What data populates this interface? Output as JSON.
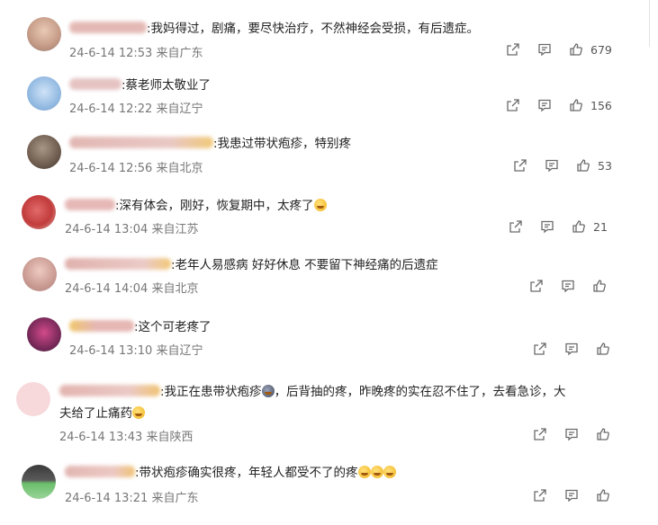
{
  "comments": [
    {
      "text": ":我妈得过，剧痛，要尽快治疗，不然神经会受损，有后遗症。",
      "date": "24-6-14 12:53",
      "location": "来自广东",
      "likes": "679"
    },
    {
      "text": ":蔡老师太敬业了",
      "date": "24-6-14 12:22",
      "location": "来自辽宁",
      "likes": "156"
    },
    {
      "text": ":我患过带状疱疹，特别疼",
      "date": "24-6-14 12:56",
      "location": "来自北京",
      "likes": "53"
    },
    {
      "text": ":深有体会，刚好，恢复期中，太疼了",
      "date": "24-6-14 13:04",
      "location": "来自江苏",
      "likes": "21"
    },
    {
      "text": ":老年人易感病 好好休息 不要留下神经痛的后遗症",
      "date": "24-6-14 14:04",
      "location": "来自北京",
      "likes": ""
    },
    {
      "text": ":这个可老疼了",
      "date": "24-6-14 13:10",
      "location": "来自辽宁",
      "likes": ""
    },
    {
      "text": ":我正在患带状疱疹",
      "text2": "，后背抽的疼，昨晚疼的实在忍不住了，去看急诊，大",
      "text3": "夫给了止痛药",
      "date": "24-6-14 13:43",
      "location": "来自陕西",
      "likes": ""
    },
    {
      "text": ":带状疱疹确实很疼，年轻人都受不了的疼",
      "date": "24-6-14 13:21",
      "location": "来自广东",
      "likes": ""
    }
  ],
  "icons": {
    "share": "share-icon",
    "comment": "comment-icon",
    "like": "thumbs-up-icon"
  },
  "colors": {
    "icon": "#6a6a6a",
    "meta": "#777777",
    "text": "#222222"
  }
}
